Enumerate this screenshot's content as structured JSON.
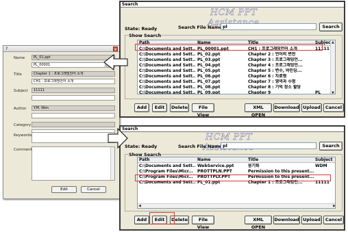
{
  "properties_dialog": {
    "title": "?",
    "close_glyph": "x",
    "labels": {
      "name": "Name",
      "title": "Title",
      "subject": "Subject",
      "author": "Author",
      "category": "Category",
      "keywords": "Keywords",
      "comments": "Comments"
    },
    "name_value": "PL_01.ppt",
    "name_sub_value": "PL_00001",
    "name_sub_suffix": "pptx",
    "title_value": "Chapter 1 : 프로그래밍언어 소개",
    "title_sub_value": "CH1 : 프로그래밍언어 소개",
    "subject_value": "11111",
    "author_value": "Y.M. Won",
    "edit_label": "Edit",
    "cancel_label": "Cancel"
  },
  "search_top": {
    "window_title": "Search",
    "logo": "HCM PPT Assistance",
    "state": "State: Ready",
    "search_file_label": "Search File Name :",
    "search_value": "pl",
    "search_button": "Search",
    "group_label": "Show Search",
    "columns": [
      "Path",
      "Name",
      "Title",
      "Subject"
    ],
    "rows": [
      [
        "C:\\Documents and Sett...",
        "PL_00001.ppt",
        "CH1 : 프로그래밍언어 소개",
        "11111"
      ],
      [
        "C:\\Documents and Sett...",
        "PL_02.ppt",
        "Chapter 2 : 언어의 변천",
        ""
      ],
      [
        "C:\\Documents and Sett...",
        "PL_03.ppt",
        "Chapter 3 : 프로그래밍언...",
        ""
      ],
      [
        "C:\\Documents and Sett...",
        "PL_04.ppt",
        "Chapter 4 : 프로그래밍언...",
        ""
      ],
      [
        "C:\\Documents and Sett...",
        "PL_05.ppt",
        "Chapter 5 : 변수, 바인딩...",
        ""
      ],
      [
        "C:\\Documents and Sett...",
        "PL_06.ppt",
        "Chapter 6 : 자료형",
        ""
      ],
      [
        "C:\\Documents and Sett...",
        "PL_07.ppt",
        "Chapter 7 : 영역과 수명",
        ""
      ],
      [
        "C:\\Documents and Sett...",
        "PL_08.ppt",
        "Chapter 8 : 기억 장소 할당",
        ""
      ],
      [
        "C:\\Documents and Sett...",
        "PL_09.ppt",
        "Chapter 9",
        "PL"
      ]
    ],
    "buttons": [
      "Add",
      "Edit",
      "Delete",
      "File View",
      "XML OPEN",
      "Download",
      "Upload",
      "Cancel"
    ]
  },
  "search_bottom": {
    "window_title": "Search",
    "logo": "HCM PPT Assistance",
    "state": "State: Ready",
    "search_file_label": "Search File Name :",
    "search_value": "pl",
    "search_button": "Search",
    "group_label": "Show Search",
    "columns": [
      "Path",
      "Name",
      "Title",
      "Subject"
    ],
    "rows": [
      [
        "C:\\Documents and Sett...",
        "WebService.ppt",
        "웅기화",
        "WDM"
      ],
      [
        "C:\\Program Files\\Micr...",
        "PROTTPLN.PPT",
        "Permission to this present...",
        ""
      ],
      [
        "C:\\Program Files\\Micr...",
        "PROTTPLY.PPT",
        "Permission to this present...",
        ""
      ],
      [
        "C:\\Documents and Sett...",
        "PL_01.ppt",
        "Chapter 1 : 프로그래밍언...",
        "11111"
      ]
    ],
    "buttons": [
      "Add",
      "Edit",
      "Delete",
      "File View",
      "XML OPEN",
      "Download",
      "Upload",
      "Cancel"
    ]
  },
  "colors": {
    "highlight": "#d23a3a",
    "window_bg": "#ece9d8"
  }
}
